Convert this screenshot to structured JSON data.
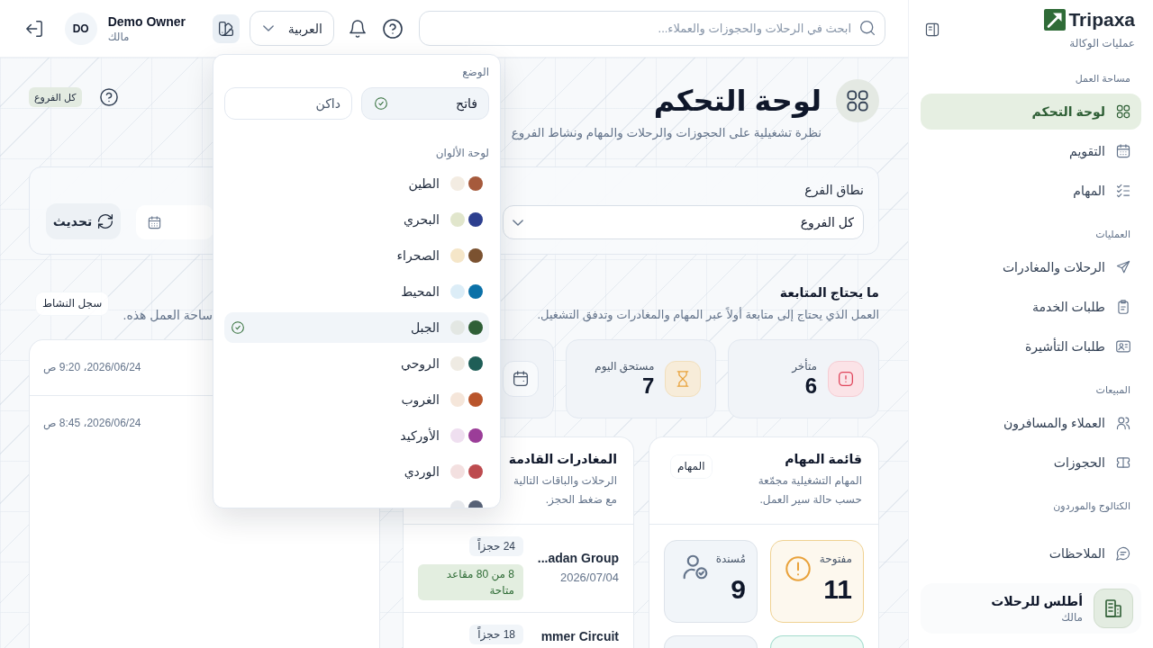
{
  "sidebar": {
    "brand": {
      "name": "Tripaxa",
      "subtitle": "عمليات الوكالة"
    },
    "sections": [
      {
        "label": "مساحة العمل",
        "items": [
          {
            "label": "لوحة التحكم",
            "selected": true
          },
          {
            "label": "التقويم",
            "selected": false
          },
          {
            "label": "المهام",
            "selected": false
          }
        ]
      },
      {
        "label": "العمليات",
        "items": [
          {
            "label": "الرحلات والمغادرات",
            "selected": false
          },
          {
            "label": "طلبات الخدمة",
            "selected": false
          },
          {
            "label": "طلبات التأشيرة",
            "selected": false
          }
        ]
      },
      {
        "label": "المبيعات",
        "items": [
          {
            "label": "العملاء والمسافرون",
            "selected": false
          },
          {
            "label": "الحجوزات",
            "selected": false
          }
        ]
      },
      {
        "label": "الكتالوج والموردون"
      },
      {
        "items": [
          {
            "label": "الملاحظات",
            "selected": false
          }
        ]
      }
    ],
    "organization": {
      "name": "أطلس للرحلات",
      "role": "مالك"
    }
  },
  "top_bar": {
    "search": {
      "placeholder": "ابحث في الرحلات والحجوزات والعملاء..."
    },
    "language": "العربية",
    "theme_menu_open": true,
    "user": {
      "initials": "DO",
      "name": "Demo Owner",
      "role": "مالك"
    }
  },
  "theme_menu": {
    "mode_label": "الوضع",
    "modes": [
      {
        "label": "فاتح",
        "selected": true
      },
      {
        "label": "داكن",
        "selected": false
      }
    ],
    "palette_label": "لوحة الألوان",
    "palettes": [
      {
        "name": "الطين",
        "swatches": [
          {
            "color": "#a65a3c"
          },
          {
            "color": "#f3ece2"
          }
        ],
        "selected": false
      },
      {
        "name": "البحري",
        "swatches": [
          {
            "color": "#2d3f8f"
          },
          {
            "color": "#e1e6cc"
          }
        ],
        "selected": false
      },
      {
        "name": "الصحراء",
        "swatches": [
          {
            "color": "#7b5230"
          },
          {
            "color": "#f5e6c8"
          }
        ],
        "selected": false
      },
      {
        "name": "المحيط",
        "swatches": [
          {
            "color": "#0b71a8"
          },
          {
            "color": "#dcedf7"
          }
        ],
        "selected": false
      },
      {
        "name": "الجبل",
        "swatches": [
          {
            "color": "#2f5f36"
          },
          {
            "color": "#e3e7e3"
          }
        ],
        "selected": true
      },
      {
        "name": "الروحي",
        "swatches": [
          {
            "color": "#1f5e57"
          },
          {
            "color": "#efebe3"
          }
        ],
        "selected": false
      },
      {
        "name": "الغروب",
        "swatches": [
          {
            "color": "#b9552b"
          },
          {
            "color": "#f5e6da"
          }
        ],
        "selected": false
      },
      {
        "name": "الأوركيد",
        "swatches": [
          {
            "color": "#9b3d98"
          },
          {
            "color": "#efdff0"
          }
        ],
        "selected": false
      },
      {
        "name": "الوردي",
        "swatches": [
          {
            "color": "#bd4b4f"
          },
          {
            "color": "#f3e0e0"
          }
        ],
        "selected": false
      },
      {
        "swatches": [
          {
            "color": "#566176"
          },
          {
            "color": "#e7e9ed"
          }
        ],
        "selected": false
      }
    ]
  },
  "page": {
    "title": "لوحة التحكم",
    "subtitle": "نظرة تشغيلية على الحجوزات والرحلات والمهام ونشاط الفروع",
    "scope_badge": "كل الفروع"
  },
  "filters": {
    "branch_label": "نطاق الفرع",
    "branch_value": "كل الفروع",
    "refresh_label": "تحديث"
  },
  "follow_up": {
    "title": "ما يحتاج المتابعة",
    "subtitle": "العمل الذي يحتاج إلى متابعة أولاً عبر المهام والمغادرات وتدفق التشغيل.",
    "metrics": [
      {
        "kind": "danger",
        "label": "متأخر",
        "value": "6"
      },
      {
        "kind": "warning",
        "label": "مستحق اليوم",
        "value": "7"
      },
      {
        "kind": "neutral"
      }
    ]
  },
  "activity": {
    "subtitle": "ساحة العمل هذه.",
    "link": "سجل النشاط",
    "entries": [
      {
        "time": "2026/06/24، 9:20 ص"
      },
      {
        "time": "2026/06/24، 8:45 ص"
      }
    ]
  },
  "task_queue": {
    "title": "قائمة المهام",
    "subtitle": "المهام التشغيلية مجمّعة حسب حالة سير العمل.",
    "link": "المهام",
    "tiles": [
      {
        "kind": "warning",
        "label": "مفتوحة",
        "value": "11"
      },
      {
        "kind": "neutral",
        "label": "مُسندة",
        "value": "9"
      },
      {
        "kind": "success"
      },
      {
        "kind": "neutral"
      }
    ]
  },
  "departures": {
    "title": "المغادرات القادمة",
    "subtitle": "الرحلات والباقات التالية مع ضغط الحجز.",
    "rows": [
      {
        "name": "...adan Group",
        "date": "2026/07/04",
        "bookings": "24 حجزاً",
        "seats": "8 من 80 مقاعد متاحة"
      },
      {
        "name": "mmer Circuit",
        "bookings": "18 حجزاً"
      }
    ]
  }
}
